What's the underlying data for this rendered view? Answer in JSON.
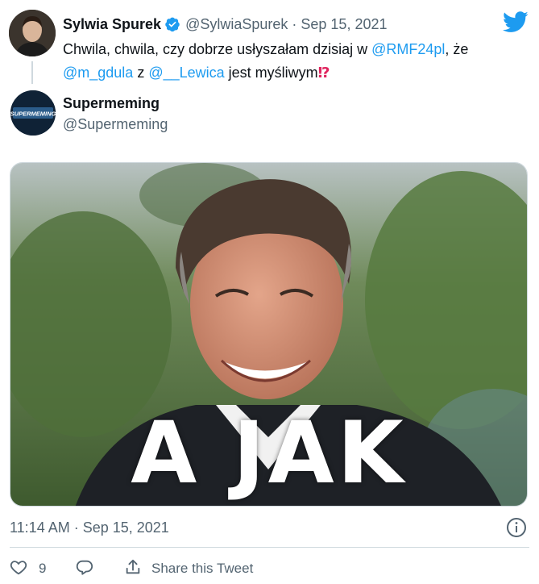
{
  "quoted_tweet": {
    "author_name": "Sylwia Spurek",
    "author_handle": "@SylwiaSpurek",
    "date": "Sep 15, 2021",
    "text_parts": [
      "Chwila, chwila, czy dobrze usłyszałam dzisiaj w ",
      "@RMF24pl",
      ", że",
      "@m_gdula",
      " z ",
      "@__Lewica",
      " jest myśliwym",
      "⁉"
    ]
  },
  "reply": {
    "author_name": "Supermeming",
    "author_handle": "@Supermeming",
    "avatar_text": "SUPERMEMING"
  },
  "media": {
    "caption": "A JAK"
  },
  "footer": {
    "timestamp": "11:14 AM · Sep 15, 2021",
    "like_count": "9",
    "share_label": "Share this Tweet"
  },
  "colors": {
    "accent": "#1d9bf0",
    "secondary_text": "#536471",
    "interrobang": "#e0245e"
  },
  "icons": [
    "verified-badge-icon",
    "twitter-bird-icon",
    "info-icon",
    "heart-icon",
    "reply-bubble-icon",
    "share-icon"
  ]
}
